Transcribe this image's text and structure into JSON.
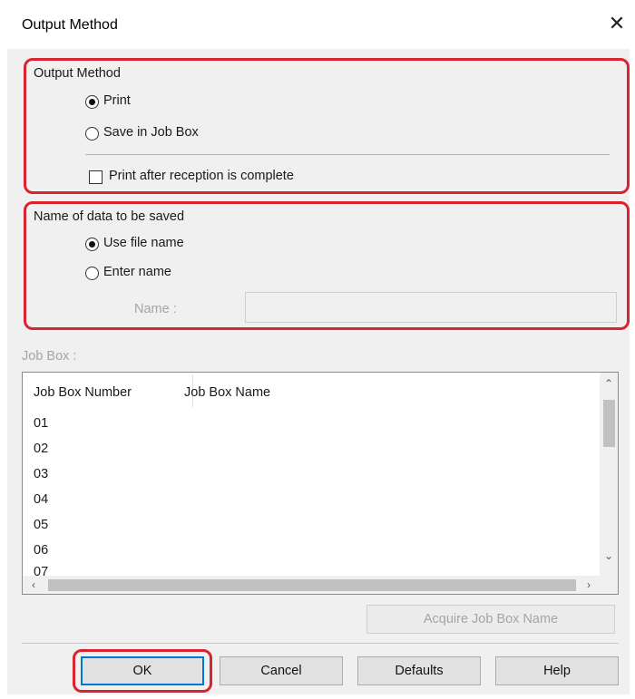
{
  "window": {
    "title": "Output Method",
    "close_glyph": "✕"
  },
  "output_method": {
    "group_label": "Output Method",
    "options": [
      {
        "label": "Print",
        "selected": true
      },
      {
        "label": "Save in Job Box",
        "selected": false
      }
    ],
    "print_after_label": "Print after reception is complete",
    "print_after_checked": false
  },
  "data_name": {
    "group_label": "Name of data to be saved",
    "options": [
      {
        "label": "Use file name",
        "selected": true
      },
      {
        "label": "Enter name",
        "selected": false
      }
    ],
    "name_label": "Name :",
    "name_value": ""
  },
  "job_box": {
    "label": "Job Box :",
    "columns": [
      "Job Box Number",
      "Job Box Name"
    ],
    "rows": [
      {
        "number": "01",
        "name": ""
      },
      {
        "number": "02",
        "name": ""
      },
      {
        "number": "03",
        "name": ""
      },
      {
        "number": "04",
        "name": ""
      },
      {
        "number": "05",
        "name": ""
      },
      {
        "number": "06",
        "name": ""
      },
      {
        "number": "07",
        "name": ""
      }
    ],
    "acquire_label": "Acquire Job Box Name"
  },
  "buttons": {
    "ok": "OK",
    "cancel": "Cancel",
    "defaults": "Defaults",
    "help": "Help"
  },
  "colors": {
    "highlight": "#d9232e",
    "focus": "#0078d7"
  }
}
